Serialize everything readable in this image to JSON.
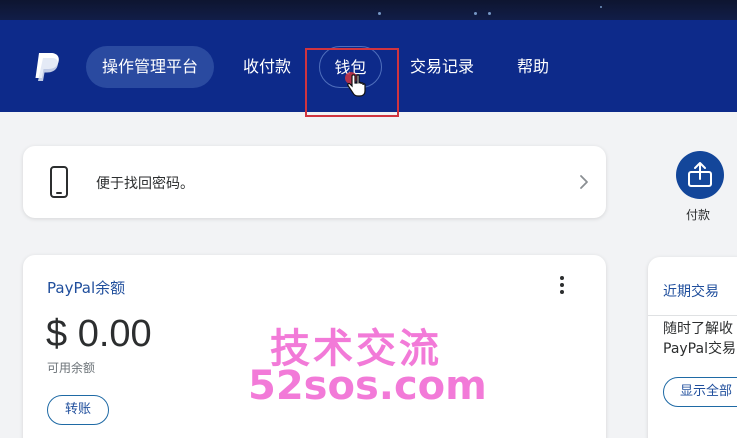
{
  "nav": {
    "items": [
      {
        "label": "操作管理平台"
      },
      {
        "label": "收付款"
      },
      {
        "label": "钱包"
      },
      {
        "label": "交易记录"
      },
      {
        "label": "帮助"
      }
    ]
  },
  "notice": {
    "text": "便于找回密码。"
  },
  "balance": {
    "title": "PayPal余额",
    "amount": "$ 0.00",
    "sub": "可用余额",
    "transfer_label": "转账"
  },
  "right": {
    "pay_label": "付款",
    "recent_title": "近期交易",
    "recent_desc_line1": "随时了解收",
    "recent_desc_line2": "PayPal交易",
    "show_all_label": "显示全部"
  },
  "watermark": {
    "line1": "技术交流",
    "line2": "52sos.com"
  }
}
